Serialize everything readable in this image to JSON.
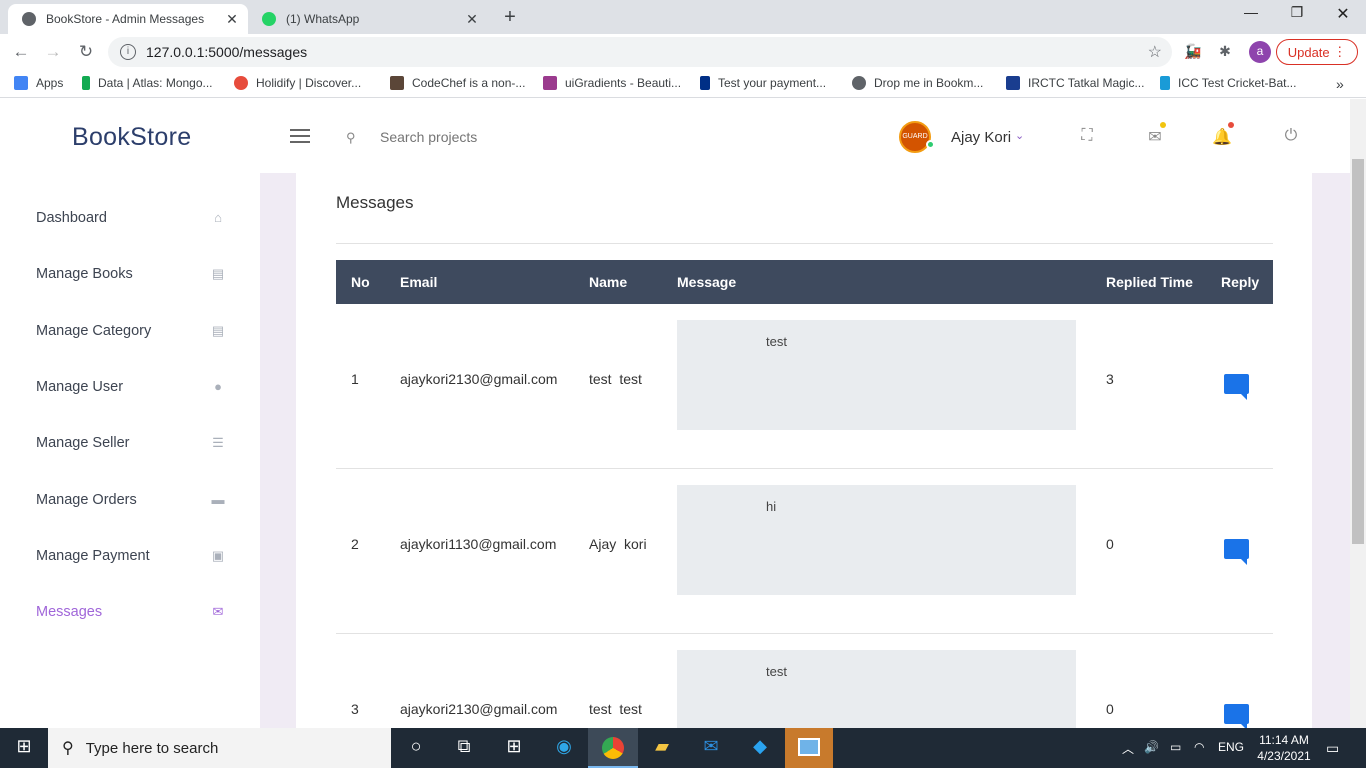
{
  "browser": {
    "tabs": [
      {
        "title": "BookStore - Admin Messages",
        "active": true
      },
      {
        "title": "(1) WhatsApp",
        "active": false
      }
    ],
    "url": "127.0.0.1:5000/messages",
    "profile_initial": "a",
    "update_label": "Update",
    "bookmarks": [
      {
        "label": "Apps",
        "color": "#4285f4"
      },
      {
        "label": "Data | Atlas: Mongo...",
        "color": "#13aa52"
      },
      {
        "label": "Holidify | Discover...",
        "color": "#e74c3c"
      },
      {
        "label": "CodeChef is a non-...",
        "color": "#5b4638"
      },
      {
        "label": "uiGradients - Beauti...",
        "color": "#9b3b8e"
      },
      {
        "label": "Test your payment...",
        "color": "#002f86"
      },
      {
        "label": "Drop me in Bookm...",
        "color": "#5f6368"
      },
      {
        "label": "IRCTC Tatkal Magic...",
        "color": "#1a3d8f"
      },
      {
        "label": "ICC Test Cricket-Bat...",
        "color": "#1a9bd7"
      }
    ]
  },
  "app": {
    "brand": "BookStore",
    "search_placeholder": "Search projects",
    "user_name": "Ajay Kori",
    "avatar_text": "GUARD",
    "sidebar": [
      {
        "label": "Dashboard",
        "icon": "home-icon",
        "active": false
      },
      {
        "label": "Manage Books",
        "icon": "books-icon",
        "active": false
      },
      {
        "label": "Manage Category",
        "icon": "category-icon",
        "active": false
      },
      {
        "label": "Manage User",
        "icon": "user-icon",
        "active": false
      },
      {
        "label": "Manage Seller",
        "icon": "list-icon",
        "active": false
      },
      {
        "label": "Manage Orders",
        "icon": "truck-icon",
        "active": false
      },
      {
        "label": "Manage Payment",
        "icon": "money-icon",
        "active": false
      },
      {
        "label": "Messages",
        "icon": "mail-icon",
        "active": true
      }
    ],
    "page_title": "Messages",
    "table": {
      "headers": [
        "No",
        "Email",
        "Name",
        "Message",
        "Replied Time",
        "Reply"
      ],
      "rows": [
        {
          "no": "1",
          "email": "ajaykori2130@gmail.com",
          "name": "test  test",
          "message": "test",
          "replied": "3"
        },
        {
          "no": "2",
          "email": "ajaykori1130@gmail.com",
          "name": "Ajay  kori",
          "message": "hi",
          "replied": "0"
        },
        {
          "no": "3",
          "email": "ajaykori2130@gmail.com",
          "name": "test  test",
          "message": "test",
          "replied": "0"
        }
      ]
    }
  },
  "taskbar": {
    "search_placeholder": "Type here to search",
    "lang": "ENG",
    "time": "11:14 AM",
    "date": "4/23/2021"
  },
  "colors": {
    "accent": "#a066d9",
    "table_header": "#3e4a5e",
    "reply_icon": "#1a73e8"
  }
}
